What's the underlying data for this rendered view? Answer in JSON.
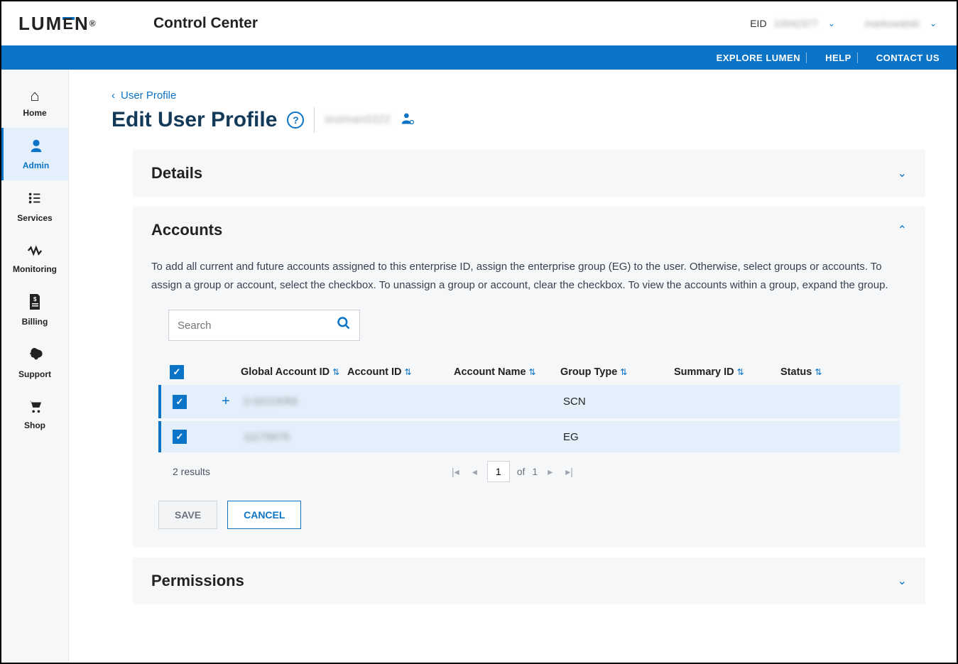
{
  "header": {
    "logo": "LUMEN",
    "app_title": "Control Center",
    "eid_label": "EID",
    "eid_value": "10042377",
    "username": "markowalski"
  },
  "utility_links": {
    "explore": "EXPLORE LUMEN",
    "help": "HELP",
    "contact": "CONTACT US"
  },
  "sidebar": {
    "items": [
      {
        "label": "Home"
      },
      {
        "label": "Admin"
      },
      {
        "label": "Services"
      },
      {
        "label": "Monitoring"
      },
      {
        "label": "Billing"
      },
      {
        "label": "Support"
      },
      {
        "label": "Shop"
      }
    ]
  },
  "breadcrumb": {
    "back_label": "User Profile"
  },
  "page": {
    "title": "Edit User Profile",
    "user_name": "testman0322"
  },
  "panels": {
    "details": {
      "title": "Details"
    },
    "accounts": {
      "title": "Accounts",
      "description": "To add all current and future accounts assigned to this enterprise ID, assign the enterprise group (EG) to the user. Otherwise, select groups or accounts. To assign a group or account, select the checkbox. To unassign a group or account, clear the checkbox. To view the accounts within a group, expand the group.",
      "search_placeholder": "Search",
      "columns": {
        "global_account_id": "Global Account ID",
        "account_id": "Account ID",
        "account_name": "Account Name",
        "group_type": "Group Type",
        "summary_id": "Summary ID",
        "status": "Status"
      },
      "rows": [
        {
          "global_account_id": "2-GCCKR6",
          "account_id": "",
          "account_name": "",
          "group_type": "SCN",
          "summary_id": "",
          "status": "",
          "expand": "+"
        },
        {
          "global_account_id": "11175676",
          "account_id": "",
          "account_name": "",
          "group_type": "EG",
          "summary_id": "",
          "status": "",
          "expand": ""
        }
      ],
      "results_count": "2 results",
      "pager": {
        "current": "1",
        "of_label": "of",
        "total_pages": "1"
      },
      "actions": {
        "save": "SAVE",
        "cancel": "CANCEL"
      }
    },
    "permissions": {
      "title": "Permissions"
    }
  }
}
